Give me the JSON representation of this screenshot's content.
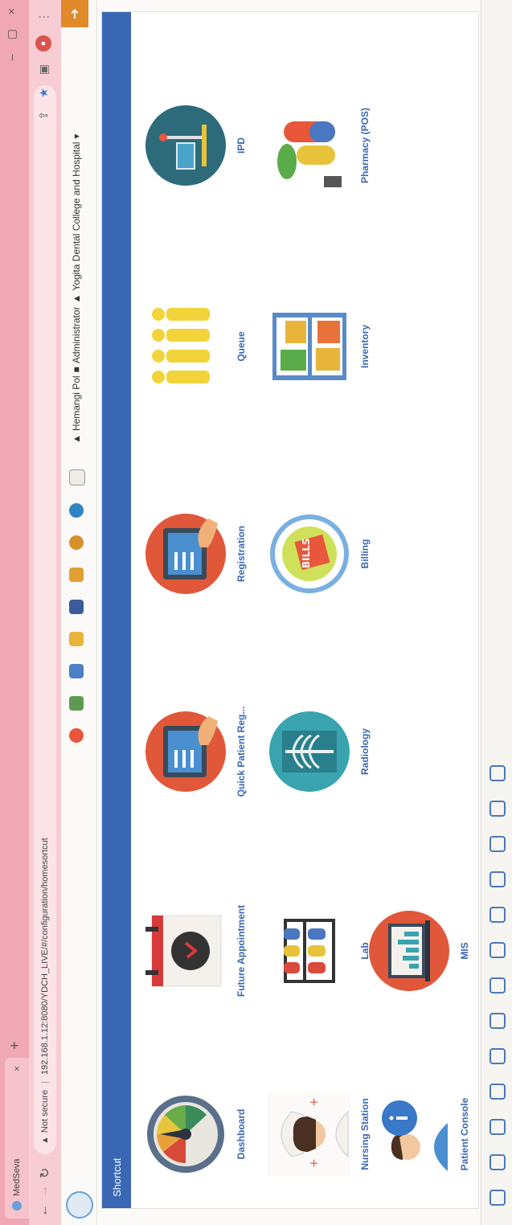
{
  "browser": {
    "tab_title": "MedSeva",
    "tab_close": "×",
    "new_tab": "+",
    "security_label": "Not secure",
    "url": "192.168.1.12:8080/YDCH_LIVE/#/configuration/homesortcut",
    "win_min": "–",
    "win_max": "▢",
    "win_close": "×",
    "profile_initial": "",
    "menu": "⋮"
  },
  "header": {
    "user_name": "Hemangi Pol",
    "role": "Administrator",
    "organization": "Yogita Dental College and Hospital",
    "dropdown_caret": "▾",
    "right_button_icon": "logout-icon"
  },
  "shortcut": {
    "title": "Shortcut",
    "tiles": [
      {
        "label": "Dashboard",
        "icon": "gauge-icon"
      },
      {
        "label": "Future Appointment",
        "icon": "calendar-clock-icon"
      },
      {
        "label": "Quick Patient Reg...",
        "icon": "tablet-form-icon"
      },
      {
        "label": "Registration",
        "icon": "tablet-form-icon"
      },
      {
        "label": "Queue",
        "icon": "people-queue-icon"
      },
      {
        "label": "IPD",
        "icon": "hospital-bed-icon"
      },
      {
        "label": "Nursing Station",
        "icon": "nurse-icon"
      },
      {
        "label": "Lab",
        "icon": "test-tubes-icon"
      },
      {
        "label": "Radiology",
        "icon": "xray-icon"
      },
      {
        "label": "Billing",
        "icon": "bills-icon"
      },
      {
        "label": "Inventory",
        "icon": "shelf-icon"
      },
      {
        "label": "Pharmacy (POS)",
        "icon": "pills-icon"
      },
      {
        "label": "Patient Console",
        "icon": "patient-info-icon"
      },
      {
        "label": "MIS",
        "icon": "monitor-chart-icon"
      }
    ]
  },
  "colors": {
    "accent": "#3a67b3",
    "tab_bg": "#f0a8b4",
    "orange": "#e08a2a"
  }
}
